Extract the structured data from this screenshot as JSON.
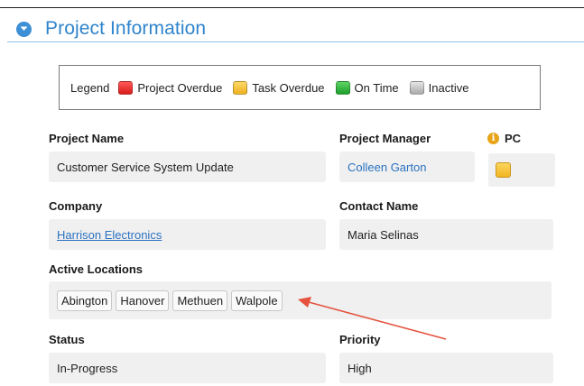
{
  "section": {
    "title": "Project Information",
    "collapse_icon": "chevron-down-icon",
    "accent_color": "#2f84cc"
  },
  "legend": {
    "title": "Legend",
    "items": [
      {
        "label": "Project Overdue",
        "color": "#e02020"
      },
      {
        "label": "Task Overdue",
        "color": "#f5c037"
      },
      {
        "label": "On Time",
        "color": "#2bb33a"
      },
      {
        "label": "Inactive",
        "color": "#bdbdbd"
      }
    ]
  },
  "fields": {
    "project_name": {
      "label": "Project Name",
      "value": "Customer Service System Update"
    },
    "project_manager": {
      "label": "Project Manager",
      "value": "Colleen Garton"
    },
    "pc": {
      "label": "PC",
      "status_color": "#f5c037",
      "icon": "info-icon"
    },
    "company": {
      "label": "Company",
      "value": "Harrison Electronics"
    },
    "contact_name": {
      "label": "Contact Name",
      "value": "Maria Selinas"
    },
    "active_locations": {
      "label": "Active Locations",
      "tags": [
        "Abington",
        "Hanover",
        "Methuen",
        "Walpole"
      ]
    },
    "status": {
      "label": "Status",
      "value": "In-Progress"
    },
    "priority": {
      "label": "Priority",
      "value": "High"
    }
  },
  "annotation": {
    "arrow_color": "#e5533f"
  }
}
